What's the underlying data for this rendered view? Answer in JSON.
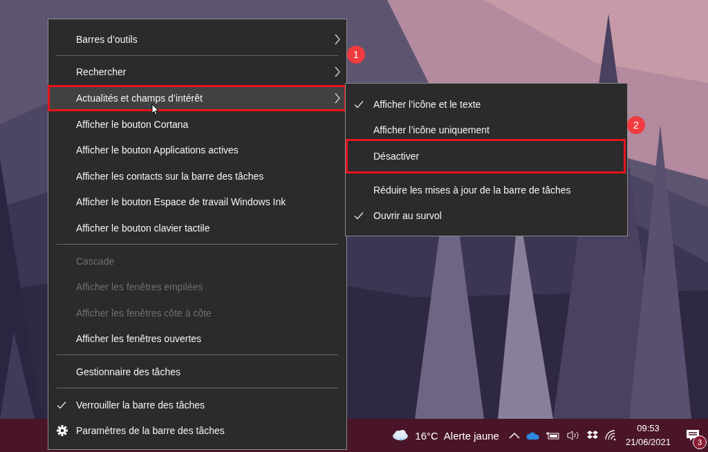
{
  "context_menu": {
    "items": [
      {
        "kind": "item",
        "label": "Barres d’outils",
        "submenu": true,
        "disabled": false,
        "checked": false,
        "selected": false
      },
      {
        "kind": "separator"
      },
      {
        "kind": "item",
        "label": "Rechercher",
        "submenu": true,
        "disabled": false,
        "checked": false,
        "selected": false,
        "callout": "1"
      },
      {
        "kind": "item",
        "label": "Actualités et champs d’intérêt",
        "submenu": true,
        "disabled": false,
        "checked": false,
        "selected": true,
        "outlined": true
      },
      {
        "kind": "item",
        "label": "Afficher le bouton Cortana",
        "disabled": false,
        "checked": false,
        "selected": false
      },
      {
        "kind": "item",
        "label": "Afficher le bouton Applications actives",
        "disabled": false,
        "checked": false,
        "selected": false
      },
      {
        "kind": "item",
        "label": "Afficher les contacts sur la barre des tâches",
        "disabled": false,
        "checked": false,
        "selected": false
      },
      {
        "kind": "item",
        "label": "Afficher le bouton Espace de travail Windows Ink",
        "disabled": false,
        "checked": false,
        "selected": false
      },
      {
        "kind": "item",
        "label": "Afficher le bouton clavier tactile",
        "disabled": false,
        "checked": false,
        "selected": false
      },
      {
        "kind": "separator"
      },
      {
        "kind": "item",
        "label": "Cascade",
        "disabled": true,
        "checked": false,
        "selected": false
      },
      {
        "kind": "item",
        "label": "Afficher les fenêtres empilées",
        "disabled": true,
        "checked": false,
        "selected": false
      },
      {
        "kind": "item",
        "label": "Afficher les fenêtres côte à côte",
        "disabled": true,
        "checked": false,
        "selected": false
      },
      {
        "kind": "item",
        "label": "Afficher les fenêtres ouvertes",
        "disabled": false,
        "checked": false,
        "selected": false
      },
      {
        "kind": "separator"
      },
      {
        "kind": "item",
        "label": "Gestionnaire des tâches",
        "disabled": false,
        "checked": false,
        "selected": false
      },
      {
        "kind": "separator"
      },
      {
        "kind": "item",
        "label": "Verrouiller la barre des tâches",
        "disabled": false,
        "checked": true,
        "selected": false
      },
      {
        "kind": "settings",
        "label": "Paramètres de la barre des tâches",
        "disabled": false,
        "checked": false,
        "selected": false
      }
    ]
  },
  "submenu": {
    "items": [
      {
        "kind": "item",
        "label": "Afficher l’icône et le texte",
        "checked": true
      },
      {
        "kind": "item",
        "label": "Afficher l’icône uniquement",
        "checked": false,
        "callout": "2"
      },
      {
        "kind": "item",
        "label": "Désactiver",
        "checked": false,
        "outlined": true
      },
      {
        "kind": "separator"
      },
      {
        "kind": "item",
        "label": "Réduire les mises à jour de la barre de tâches",
        "checked": false
      },
      {
        "kind": "item",
        "label": "Ouvrir au survol",
        "checked": true
      }
    ]
  },
  "taskbar": {
    "temperature": "16°C",
    "weather_text": "Alerte jaune",
    "time": "09:53",
    "date": "21/06/2021",
    "notification_count": "3"
  }
}
